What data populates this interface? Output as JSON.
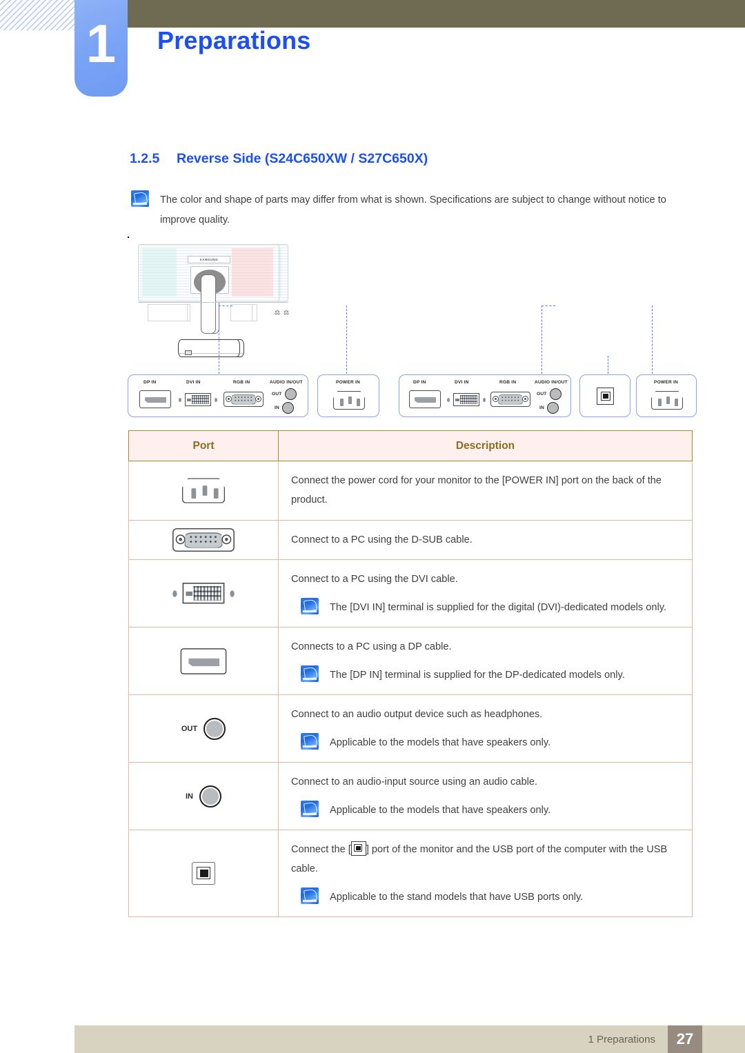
{
  "header": {
    "chapter_number": "1",
    "title": "Preparations"
  },
  "section": {
    "number": "1.2.5",
    "title": "Reverse Side (S24C650XW / S27C650X)"
  },
  "intro_note": "The color and shape of parts may differ from what is shown. Specifications are subject to change without notice to improve quality.",
  "diagrams": {
    "logo_text": "SAMSUNG",
    "left": {
      "port_groups": [
        {
          "labels": [
            "DP IN",
            "DVI IN",
            "RGB IN",
            "AUDIO IN/OUT"
          ],
          "sub_labels": [
            "OUT",
            "IN"
          ]
        },
        {
          "labels": [
            "POWER IN"
          ]
        }
      ]
    },
    "right": {
      "port_groups": [
        {
          "labels": [
            "DP IN",
            "DVI IN",
            "RGB IN",
            "AUDIO IN/OUT"
          ],
          "sub_labels": [
            "OUT",
            "IN"
          ]
        },
        {
          "labels": [
            ""
          ]
        },
        {
          "labels": [
            "POWER IN"
          ]
        }
      ]
    }
  },
  "table": {
    "headers": {
      "port": "Port",
      "description": "Description"
    },
    "rows": [
      {
        "icon": "power-in-port-icon",
        "lines": [
          "Connect the power cord for your monitor to the [POWER IN] port on the back of the product."
        ],
        "note": null
      },
      {
        "icon": "rgb-dsub-port-icon",
        "lines": [
          "Connect to a PC using the D-SUB cable."
        ],
        "note": null
      },
      {
        "icon": "dvi-in-port-icon",
        "lines": [
          "Connect to a PC using the DVI cable."
        ],
        "note": "The [DVI IN] terminal is supplied for the digital (DVI)-dedicated models only."
      },
      {
        "icon": "dp-in-port-icon",
        "lines": [
          "Connects to a PC using a DP cable."
        ],
        "note": "The [DP IN] terminal is supplied for the DP-dedicated models only."
      },
      {
        "icon": "audio-out-jack-icon",
        "jack_label": "OUT",
        "lines": [
          "Connect to an audio output device such as headphones."
        ],
        "note": "Applicable to the models that have speakers only."
      },
      {
        "icon": "audio-in-jack-icon",
        "jack_label": "IN",
        "lines": [
          "Connect to an audio-input source using an audio cable."
        ],
        "note": "Applicable to the models that have speakers only."
      },
      {
        "icon": "usb-upstream-port-icon",
        "lines_pre": "Connect the [",
        "lines_post": "] port of the monitor and the USB port of the computer with the USB cable.",
        "note": "Applicable to the stand models that have USB ports only."
      }
    ]
  },
  "footer": {
    "text": "1 Preparations",
    "page": "27"
  },
  "colors": {
    "brand_blue": "#1b4ff0",
    "chip_blue": "#7ba4f4",
    "header_bar": "#6e6b52",
    "table_border": "#a58a2a",
    "table_head_bg": "#fdf0ed",
    "table_head_text": "#8a6d1f",
    "row_border": "#e4b7a3",
    "footer_bar": "#d8d2c0",
    "footer_page_bg": "#988b80",
    "dashed_line": "#5b79e8"
  }
}
